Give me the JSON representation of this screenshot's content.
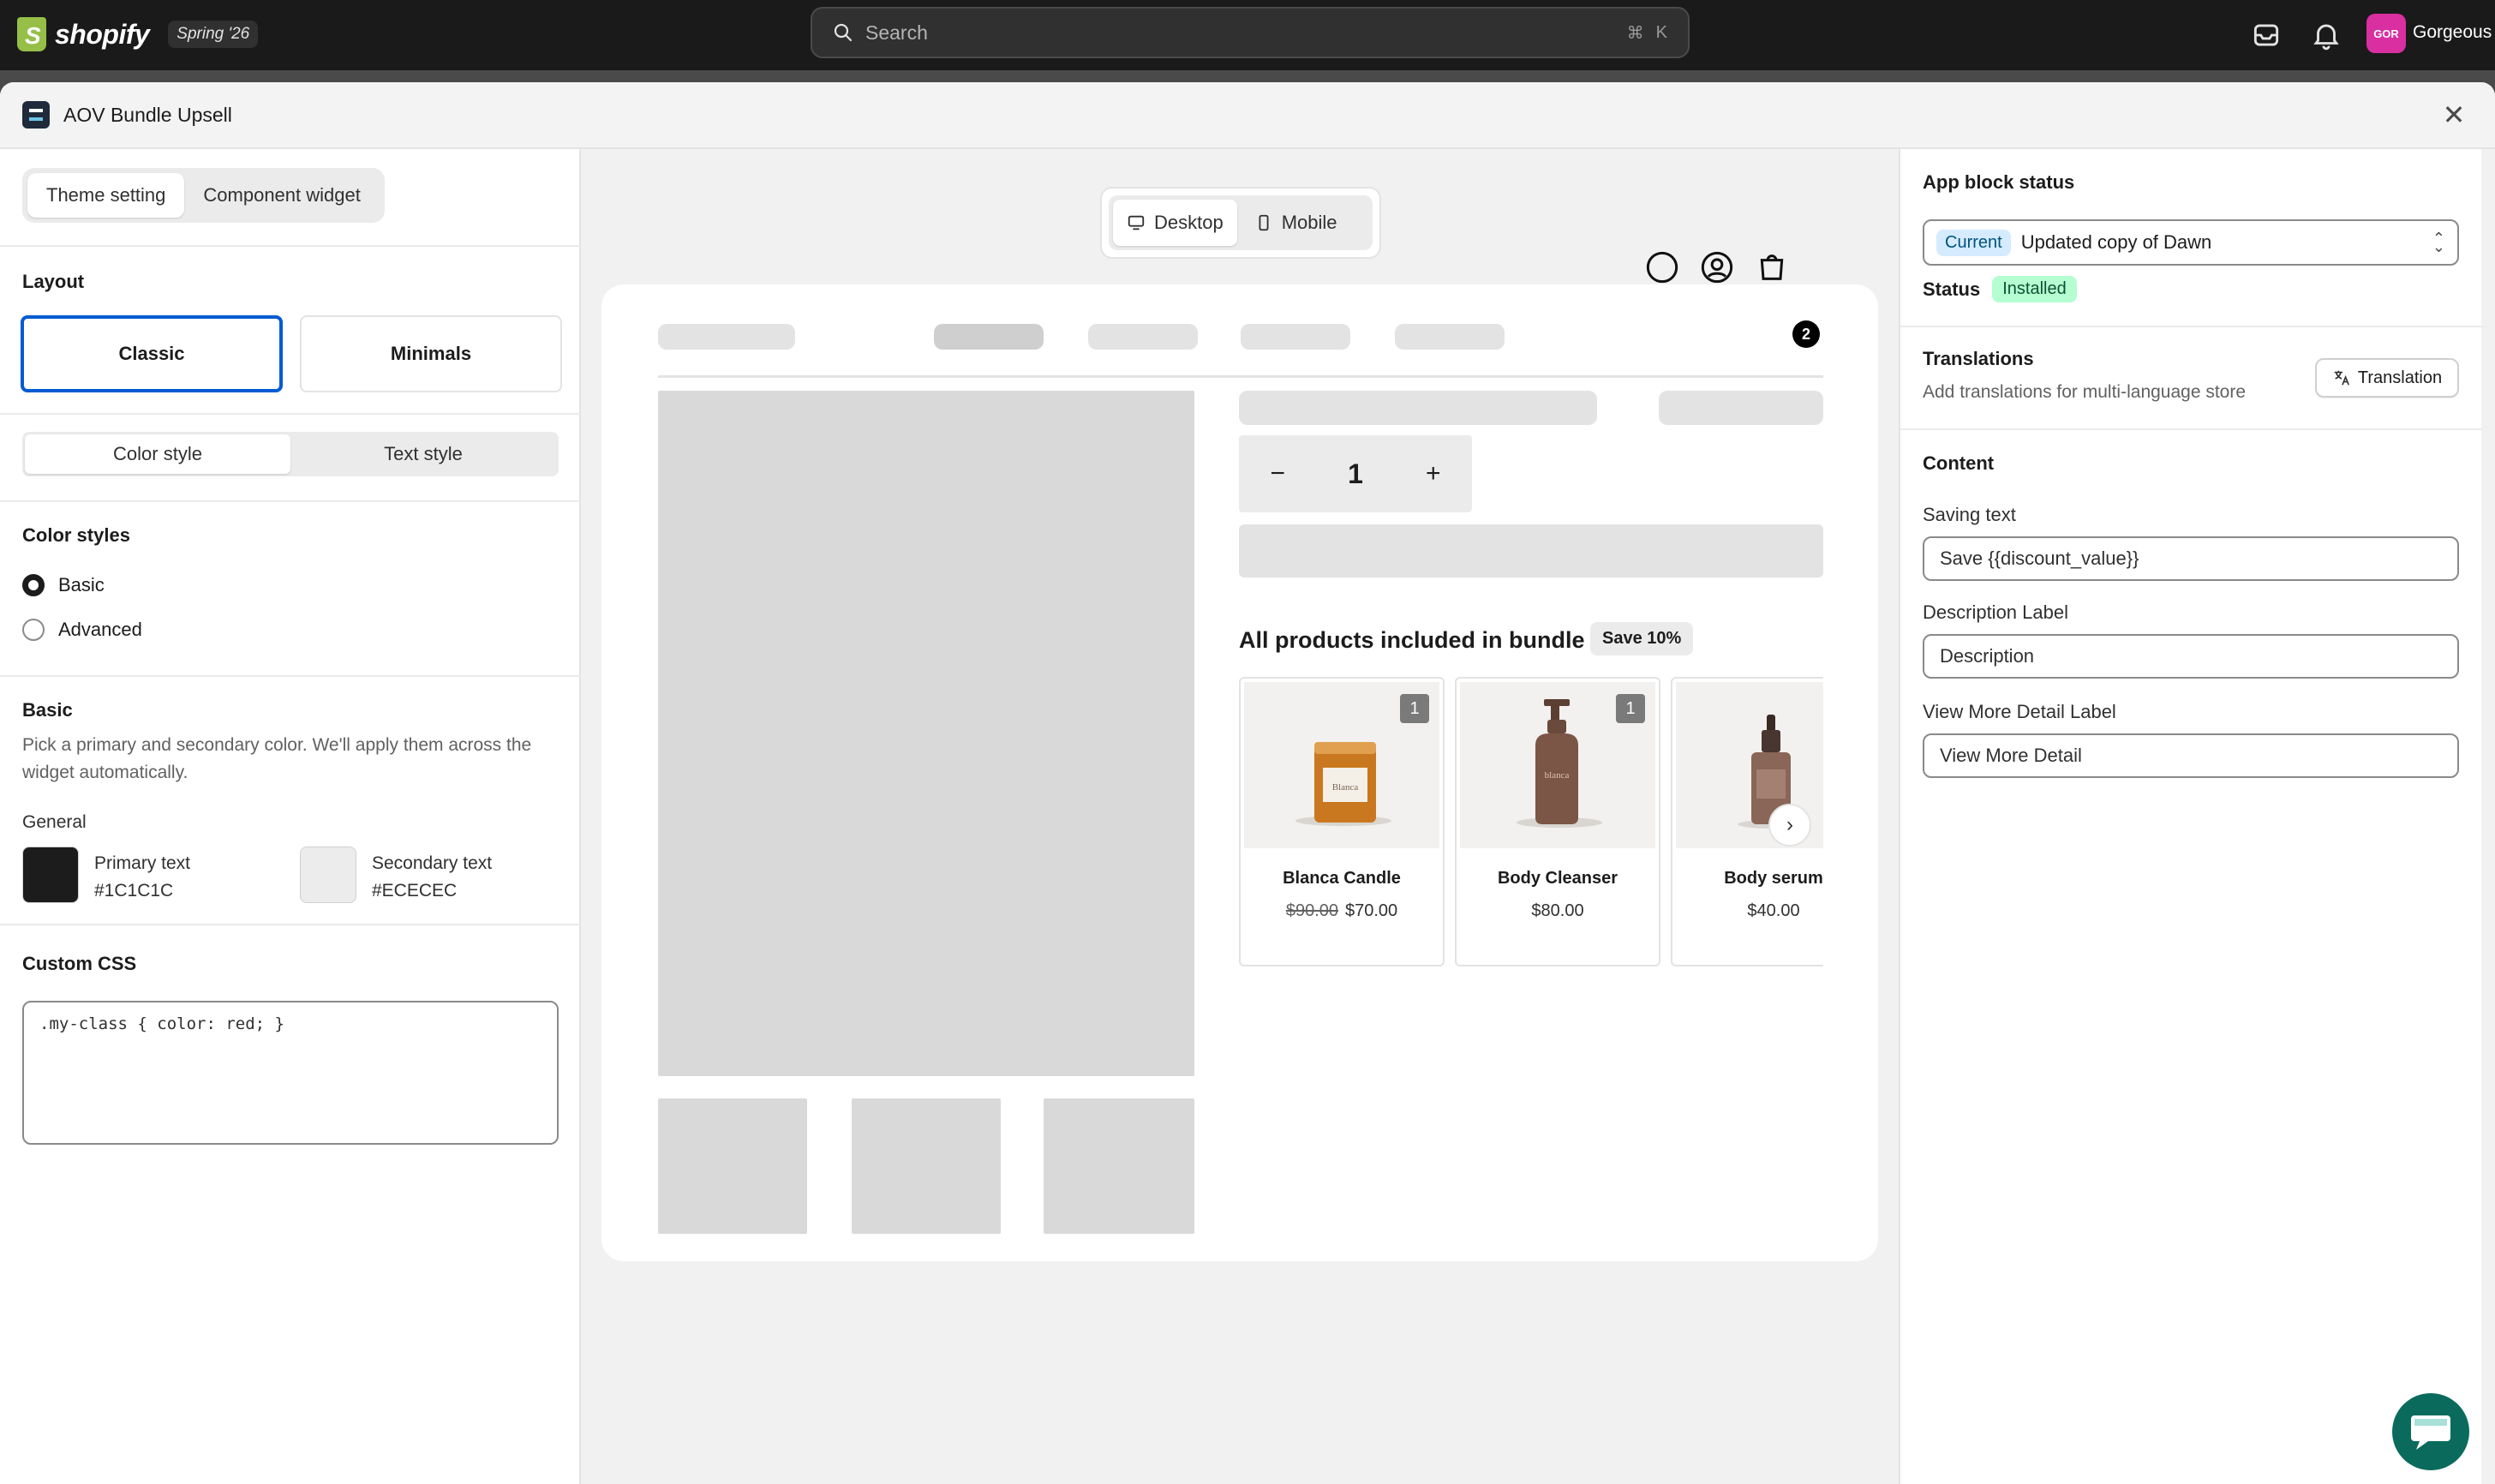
{
  "topbar": {
    "logo_text": "shopify",
    "edition": "Spring '26",
    "search_placeholder": "Search",
    "shortcut_cmd": "⌘",
    "shortcut_key": "K",
    "avatar_initials": "GOR",
    "store_name": "Gorgeous"
  },
  "modal": {
    "title": "AOV Bundle Upsell",
    "close": "✕"
  },
  "left": {
    "tabs": [
      "Theme setting",
      "Component widget"
    ],
    "layout_title": "Layout",
    "layouts": [
      "Classic",
      "Minimals"
    ],
    "style_tabs": [
      "Color style",
      "Text style"
    ],
    "color_styles_title": "Color styles",
    "radio_options": [
      "Basic",
      "Advanced"
    ],
    "basic_title": "Basic",
    "basic_help": "Pick a primary and secondary color. We'll apply them across the widget automatically.",
    "general_label": "General",
    "primary": {
      "label": "Primary text",
      "value": "#1C1C1C"
    },
    "secondary": {
      "label": "Secondary text",
      "value": "#ECECEC"
    },
    "custom_css_title": "Custom CSS",
    "custom_css_value": ".my-class { color: red; }"
  },
  "preview": {
    "devices": [
      "Desktop",
      "Mobile"
    ],
    "cart_count": "2",
    "qty_minus": "−",
    "qty_value": "1",
    "qty_plus": "+",
    "bundle_title": "All products included in bundle",
    "save_badge": "Save 10%",
    "products": [
      {
        "name": "Blanca Candle",
        "old_price": "$90.00",
        "price": "$70.00",
        "qty": "1"
      },
      {
        "name": "Body Cleanser",
        "old_price": "",
        "price": "$80.00",
        "qty": "1"
      },
      {
        "name": "Body serum",
        "old_price": "",
        "price": "$40.00",
        "qty": ""
      }
    ],
    "next": "›"
  },
  "right": {
    "app_block_title": "App block status",
    "current_chip": "Current",
    "theme_name": "Updated copy of Dawn",
    "status_label": "Status",
    "status_value": "Installed",
    "translations_title": "Translations",
    "translations_help": "Add translations for multi-language store",
    "translation_button": "Translation",
    "content_title": "Content",
    "saving_label": "Saving text",
    "saving_value": "Save {{discount_value}}",
    "description_label": "Description Label",
    "description_value": "Description",
    "view_more_label": "View More Detail Label",
    "view_more_value": "View More Detail"
  },
  "colors": {
    "primary_swatch": "#1C1C1C",
    "secondary_swatch": "#ECECEC",
    "accent": "#005bd3"
  }
}
